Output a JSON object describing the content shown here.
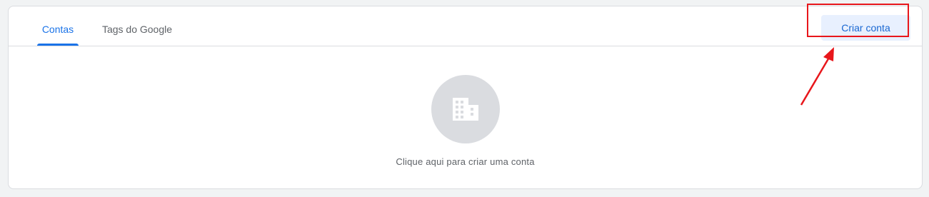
{
  "tabs": [
    {
      "label": "Contas",
      "active": true
    },
    {
      "label": "Tags do Google",
      "active": false
    }
  ],
  "toolbar": {
    "create_account_label": "Criar conta"
  },
  "empty_state": {
    "icon": "building-icon",
    "message": "Clique aqui para criar uma conta"
  },
  "annotations": {
    "highlight_color": "#e8161b"
  },
  "colors": {
    "accent": "#1a73e8",
    "button_bg": "#e8f0fe",
    "icon_circle": "#dadce0"
  }
}
